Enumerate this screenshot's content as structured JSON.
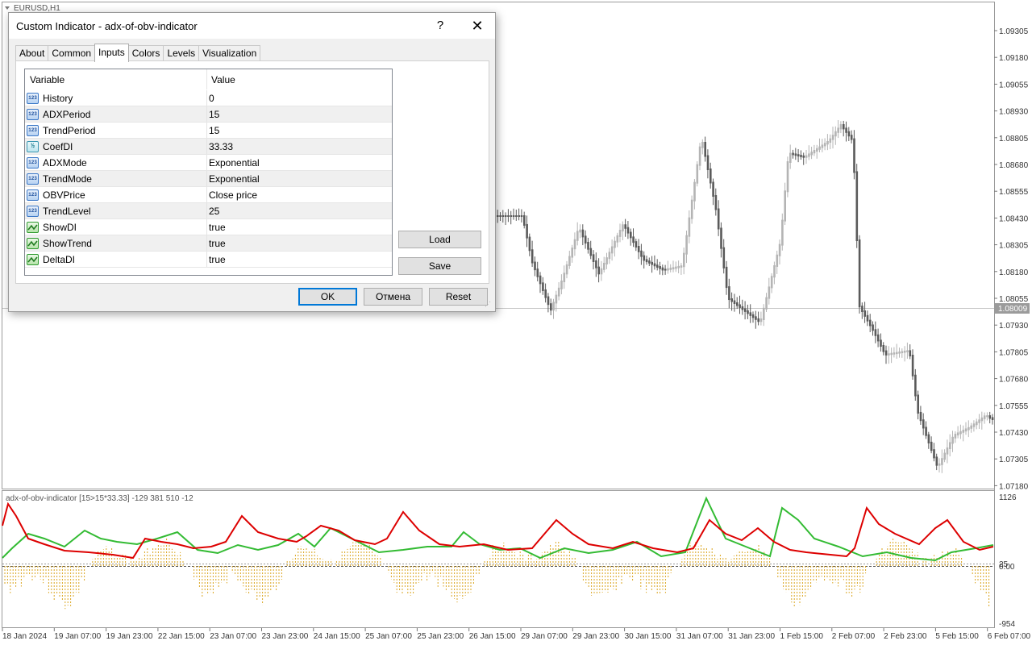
{
  "chart": {
    "symbol_label": "EURUSD,H1",
    "indicator_label": "adx-of-obv-indicator [15>15*33.33] -129 381 510 -12",
    "price_axis": [
      "1.09305",
      "1.09180",
      "1.09055",
      "1.08930",
      "1.08805",
      "1.08680",
      "1.08555",
      "1.08430",
      "1.08305",
      "1.08180",
      "1.08055",
      "1.07930",
      "1.07805",
      "1.07680",
      "1.07555",
      "1.07430",
      "1.07305",
      "1.07180"
    ],
    "current_price": "1.08009",
    "indicator_axis": [
      "1126",
      "25",
      "0.00",
      "-954"
    ],
    "time_axis": [
      "18 Jan 2024",
      "19 Jan 07:00",
      "19 Jan 23:00",
      "22 Jan 15:00",
      "23 Jan 07:00",
      "23 Jan 23:00",
      "24 Jan 15:00",
      "25 Jan 07:00",
      "25 Jan 23:00",
      "26 Jan 15:00",
      "29 Jan 07:00",
      "29 Jan 23:00",
      "30 Jan 15:00",
      "31 Jan 07:00",
      "31 Jan 23:00",
      "1 Feb 15:00",
      "2 Feb 07:00",
      "2 Feb 23:00",
      "5 Feb 15:00",
      "6 Feb 07:00"
    ],
    "colors": {
      "bull_candle": "#b4b4b4",
      "bear_candle": "#5a5a5a",
      "adx_line": "#dd0000",
      "di_line": "#33bb33",
      "histogram": "#daa520",
      "price_tag": "#9b9b9b"
    }
  },
  "dialog": {
    "title": "Custom Indicator - adx-of-obv-indicator",
    "help_label": "?",
    "close_label": "✕",
    "tabs": [
      "About",
      "Common",
      "Inputs",
      "Colors",
      "Levels",
      "Visualization"
    ],
    "active_tab": "Inputs",
    "grid": {
      "columns": [
        "Variable",
        "Value"
      ],
      "rows": [
        {
          "icon": "123",
          "type": "int",
          "name": "History",
          "value": "0"
        },
        {
          "icon": "123",
          "type": "int",
          "name": "ADXPeriod",
          "value": "15"
        },
        {
          "icon": "123",
          "type": "int",
          "name": "TrendPeriod",
          "value": "15"
        },
        {
          "icon": "½",
          "type": "double",
          "name": "CoefDI",
          "value": "33.33"
        },
        {
          "icon": "123",
          "type": "enum",
          "name": "ADXMode",
          "value": "Exponential"
        },
        {
          "icon": "123",
          "type": "enum",
          "name": "TrendMode",
          "value": "Exponential"
        },
        {
          "icon": "123",
          "type": "enum",
          "name": "OBVPrice",
          "value": "Close price"
        },
        {
          "icon": "123",
          "type": "int",
          "name": "TrendLevel",
          "value": "25"
        },
        {
          "icon": "",
          "type": "bool",
          "name": "ShowDI",
          "value": "true"
        },
        {
          "icon": "",
          "type": "bool",
          "name": "ShowTrend",
          "value": "true"
        },
        {
          "icon": "",
          "type": "bool",
          "name": "DeltaDI",
          "value": "true"
        }
      ]
    },
    "buttons": {
      "load": "Load",
      "save": "Save",
      "ok": "OK",
      "cancel": "Отмена",
      "reset": "Reset"
    }
  }
}
